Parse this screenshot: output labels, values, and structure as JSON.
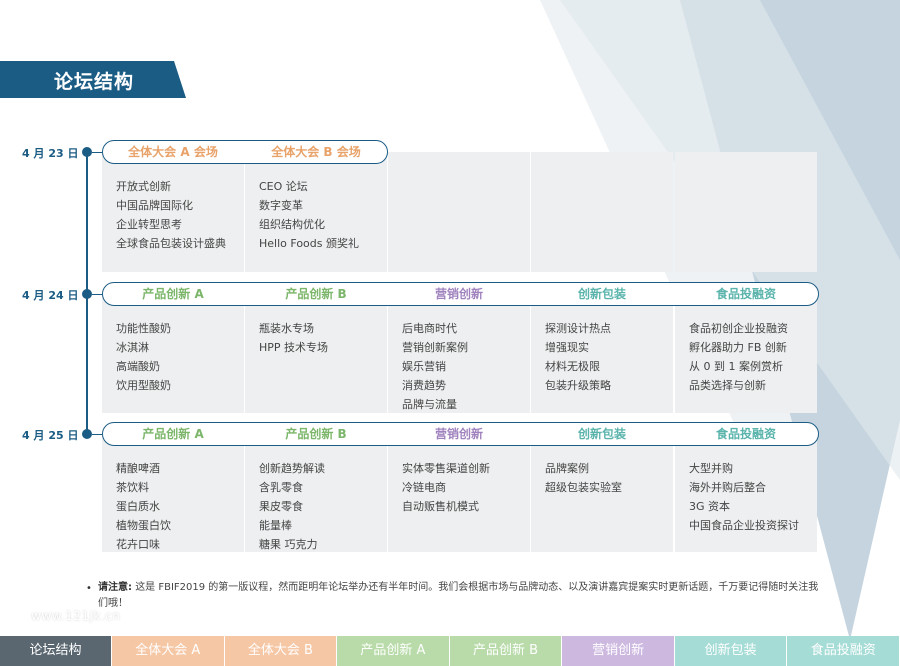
{
  "page_title": "论坛结构",
  "days": [
    {
      "date": "4 月 23 日",
      "tracks": [
        {
          "name": "全体大会 A 会场",
          "color": "#e8a36a",
          "topics": [
            "开放式创新",
            "中国品牌国际化",
            "企业转型思考",
            "全球食品包装设计盛典"
          ]
        },
        {
          "name": "全体大会 B 会场",
          "color": "#e8a36a",
          "topics": [
            "CEO 论坛",
            "数字变革",
            "组织结构优化",
            "Hello Foods 颁奖礼"
          ]
        }
      ]
    },
    {
      "date": "4 月 24 日",
      "tracks": [
        {
          "name": "产品创新 A",
          "color": "#7cb66a",
          "topics": [
            "功能性酸奶",
            "冰淇淋",
            "高端酸奶",
            "饮用型酸奶"
          ]
        },
        {
          "name": "产品创新 B",
          "color": "#7cb66a",
          "topics": [
            "瓶装水专场",
            "HPP 技术专场"
          ]
        },
        {
          "name": "营销创新",
          "color": "#a083be",
          "topics": [
            "后电商时代",
            "营销创新案例",
            "娱乐营销",
            "消费趋势",
            "品牌与流量"
          ]
        },
        {
          "name": "创新包装",
          "color": "#5ab4ac",
          "topics": [
            "探测设计热点",
            "增强现实",
            "材料无极限",
            "包装升级策略"
          ]
        },
        {
          "name": "食品投融资",
          "color": "#5ab4ac",
          "topics": [
            "食品初创企业投融资",
            "孵化器助力 FB 创新",
            "从 0 到 1 案例赏析",
            "品类选择与创新"
          ]
        }
      ]
    },
    {
      "date": "4 月 25 日",
      "tracks": [
        {
          "name": "产品创新 A",
          "color": "#7cb66a",
          "topics": [
            "精酿啤酒",
            "茶饮料",
            "蛋白质水",
            "植物蛋白饮",
            "花卉口味"
          ]
        },
        {
          "name": "产品创新 B",
          "color": "#7cb66a",
          "topics": [
            "创新趋势解读",
            "含乳零食",
            "果皮零食",
            "能量棒",
            "糖果 巧克力"
          ]
        },
        {
          "name": "营销创新",
          "color": "#a083be",
          "topics": [
            "实体零售渠道创新",
            "冷链电商",
            "自动贩售机模式"
          ]
        },
        {
          "name": "创新包装",
          "color": "#5ab4ac",
          "topics": [
            "品牌案例",
            "超级包装实验室"
          ]
        },
        {
          "name": "食品投融资",
          "color": "#5ab4ac",
          "topics": [
            "大型并购",
            "海外并购后整合",
            "3G 资本",
            "中国食品企业投资探讨"
          ]
        }
      ]
    }
  ],
  "note": {
    "bullet": "•",
    "label": "请注意:",
    "text": "这是 FBIF2019 的第一版议程，然而距明年论坛举办还有半年时间。我们会根据市场与品牌动态、以及演讲嘉宾提案实时更新话题，千万要记得随时关注我们哦！"
  },
  "watermark": "www.121jk.cn",
  "tabs": [
    {
      "label": "论坛结构",
      "color": "#5a6770"
    },
    {
      "label": "全体大会 A",
      "color": "#f6c7a5"
    },
    {
      "label": "全体大会 B",
      "color": "#f6c7a5"
    },
    {
      "label": "产品创新 A",
      "color": "#b8dba9"
    },
    {
      "label": "产品创新 B",
      "color": "#b8dba9"
    },
    {
      "label": "营销创新",
      "color": "#cdb8e0"
    },
    {
      "label": "创新包装",
      "color": "#a6dcd6"
    },
    {
      "label": "食品投融资",
      "color": "#a6dcd6"
    }
  ]
}
